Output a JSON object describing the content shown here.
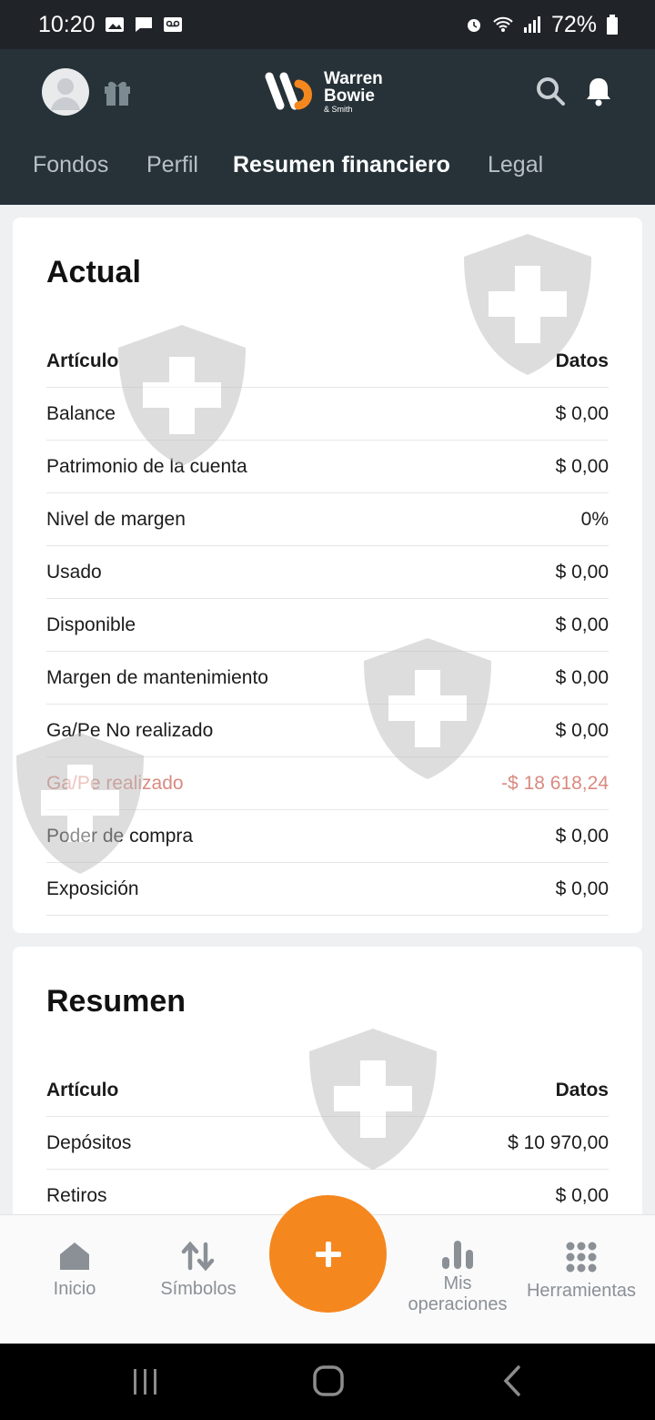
{
  "status_bar": {
    "time": "10:20",
    "battery": "72%",
    "icons": [
      "gallery-icon",
      "message-icon",
      "voicemail-icon",
      "alarm-icon",
      "wifi-icon",
      "signal-icon",
      "battery-icon"
    ]
  },
  "header": {
    "logo": {
      "line1": "Warren",
      "line2": "Bowie",
      "line3": "& Smith"
    },
    "tabs": [
      {
        "label": "Fondos"
      },
      {
        "label": "Perfil"
      },
      {
        "label": "Resumen financiero"
      },
      {
        "label": "Legal"
      }
    ],
    "active_tab": "Resumen financiero"
  },
  "actual": {
    "title": "Actual",
    "columns": [
      "Artículo",
      "Datos"
    ],
    "rows": [
      {
        "label": "Balance",
        "value": "$ 0,00"
      },
      {
        "label": "Patrimonio de la cuenta",
        "value": "$ 0,00"
      },
      {
        "label": "Nivel de margen",
        "value": "0%"
      },
      {
        "label": "Usado",
        "value": "$ 0,00"
      },
      {
        "label": "Disponible",
        "value": "$ 0,00"
      },
      {
        "label": "Margen de mantenimiento",
        "value": "$ 0,00"
      },
      {
        "label": "Ga/Pe No realizado",
        "value": "$ 0,00"
      },
      {
        "label": "Ga/Pe realizado",
        "value": "-$ 18 618,24"
      },
      {
        "label": "Poder de compra",
        "value": "$ 0,00"
      },
      {
        "label": "Exposición",
        "value": "$ 0,00"
      }
    ]
  },
  "resumen": {
    "title": "Resumen",
    "columns": [
      "Artículo",
      "Datos"
    ],
    "rows": [
      {
        "label": "Depósitos",
        "value": "$ 10 970,00"
      },
      {
        "label": "Retiros",
        "value": "$ 0,00"
      }
    ]
  },
  "bottom_nav": {
    "items": [
      {
        "label": "Inicio",
        "icon": "home-icon"
      },
      {
        "label": "Símbolos",
        "icon": "swap-icon"
      },
      {
        "label": "Mis operaciones",
        "icon": "bar-chart-icon"
      },
      {
        "label": "Herramientas",
        "icon": "grid-icon"
      }
    ],
    "fab_icon": "plus-icon"
  },
  "colors": {
    "header_bg": "#263238",
    "accent": "#f5871f",
    "negative": "#d98a80"
  }
}
